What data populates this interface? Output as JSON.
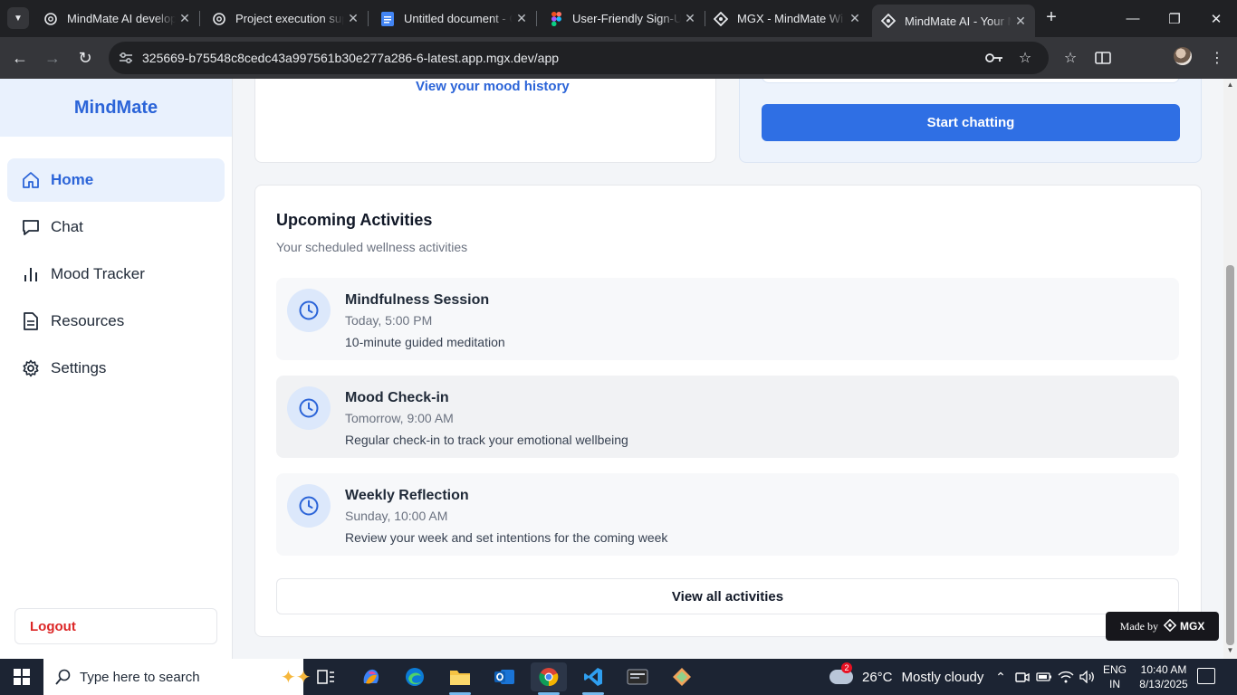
{
  "browser": {
    "tabs": [
      {
        "title": "MindMate AI develop",
        "icon": "openai-icon"
      },
      {
        "title": "Project execution sup",
        "icon": "openai-icon"
      },
      {
        "title": "Untitled document - G",
        "icon": "google-docs-icon"
      },
      {
        "title": "User-Friendly Sign-Up",
        "icon": "figma-icon"
      },
      {
        "title": "MGX - MindMate Wi",
        "icon": "mgx-icon"
      },
      {
        "title": "MindMate AI - Your M",
        "icon": "mgx-icon",
        "active": true
      }
    ],
    "url": "325669-b75548c8cedc43a997561b30e277a286-6-latest.app.mgx.dev/app"
  },
  "sidebar": {
    "brand": "MindMate",
    "items": [
      {
        "label": "Home",
        "icon": "home-icon",
        "active": true
      },
      {
        "label": "Chat",
        "icon": "chat-icon"
      },
      {
        "label": "Mood Tracker",
        "icon": "bar-chart-icon"
      },
      {
        "label": "Resources",
        "icon": "document-icon"
      },
      {
        "label": "Settings",
        "icon": "gear-icon"
      }
    ],
    "logout": "Logout"
  },
  "mood_card": {
    "link": "View your mood history"
  },
  "chat_card": {
    "button": "Start chatting"
  },
  "activities": {
    "title": "Upcoming Activities",
    "subtitle": "Your scheduled wellness activities",
    "items": [
      {
        "name": "Mindfulness Session",
        "time": "Today, 5:00 PM",
        "desc": "10-minute guided meditation"
      },
      {
        "name": "Mood Check-in",
        "time": "Tomorrow, 9:00 AM",
        "desc": "Regular check-in to track your emotional wellbeing"
      },
      {
        "name": "Weekly Reflection",
        "time": "Sunday, 10:00 AM",
        "desc": "Review your week and set intentions for the coming week"
      }
    ],
    "view_all": "View all activities"
  },
  "badge": {
    "made_by": "Made by",
    "brand": "MGX"
  },
  "taskbar": {
    "search_placeholder": "Type here to search",
    "weather_badge": "2",
    "temperature": "26°C",
    "condition": "Mostly cloudy",
    "lang_line1": "ENG",
    "lang_line2": "IN",
    "time": "10:40 AM",
    "date": "8/13/2025"
  },
  "colors": {
    "accent": "#2f6fe4",
    "brand": "#2b64d8",
    "logout": "#dc2626"
  }
}
